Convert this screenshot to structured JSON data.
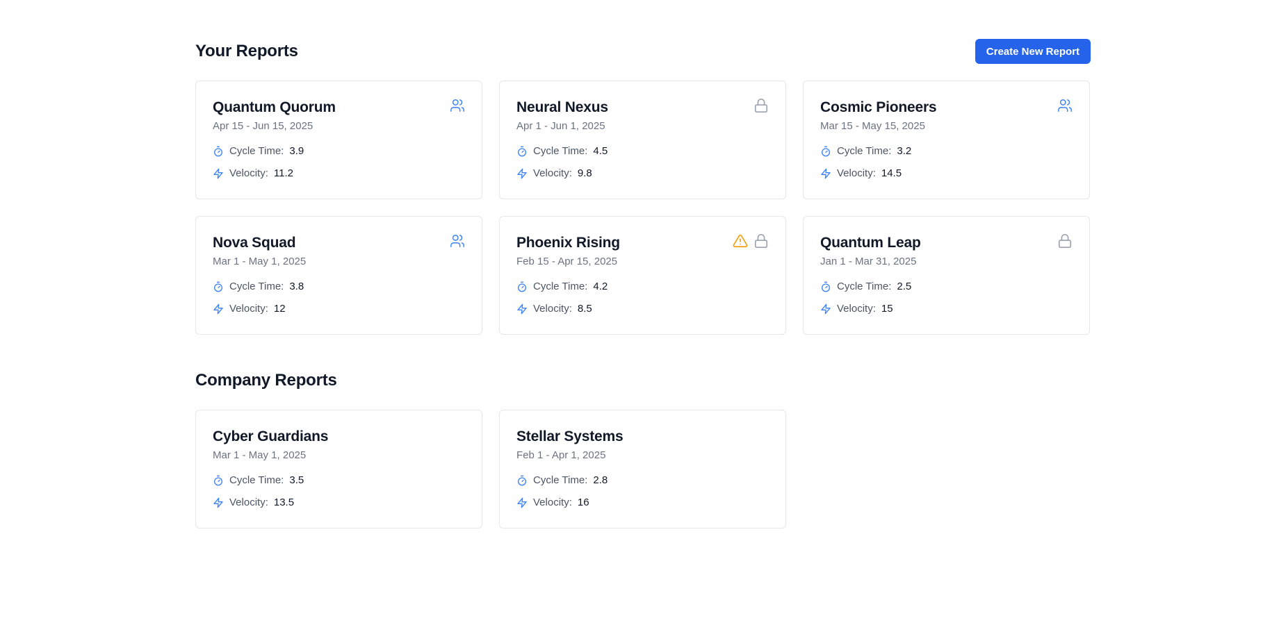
{
  "your_reports": {
    "title": "Your Reports",
    "create_button": "Create New Report",
    "cards": [
      {
        "title": "Quantum Quorum",
        "dates": "Apr 15 - Jun 15, 2025",
        "cycle_label": "Cycle Time:",
        "cycle_value": "3.9",
        "velocity_label": "Velocity:",
        "velocity_value": "11.2",
        "icons": [
          "users-icon"
        ]
      },
      {
        "title": "Neural Nexus",
        "dates": "Apr 1 - Jun 1, 2025",
        "cycle_label": "Cycle Time:",
        "cycle_value": "4.5",
        "velocity_label": "Velocity:",
        "velocity_value": "9.8",
        "icons": [
          "lock-icon"
        ]
      },
      {
        "title": "Cosmic Pioneers",
        "dates": "Mar 15 - May 15, 2025",
        "cycle_label": "Cycle Time:",
        "cycle_value": "3.2",
        "velocity_label": "Velocity:",
        "velocity_value": "14.5",
        "icons": [
          "users-icon"
        ]
      },
      {
        "title": "Nova Squad",
        "dates": "Mar 1 - May 1, 2025",
        "cycle_label": "Cycle Time:",
        "cycle_value": "3.8",
        "velocity_label": "Velocity:",
        "velocity_value": "12",
        "icons": [
          "users-icon"
        ]
      },
      {
        "title": "Phoenix Rising",
        "dates": "Feb 15 - Apr 15, 2025",
        "cycle_label": "Cycle Time:",
        "cycle_value": "4.2",
        "velocity_label": "Velocity:",
        "velocity_value": "8.5",
        "icons": [
          "warning-icon",
          "lock-icon"
        ]
      },
      {
        "title": "Quantum Leap",
        "dates": "Jan 1 - Mar 31, 2025",
        "cycle_label": "Cycle Time:",
        "cycle_value": "2.5",
        "velocity_label": "Velocity:",
        "velocity_value": "15",
        "icons": [
          "lock-icon"
        ]
      }
    ]
  },
  "company_reports": {
    "title": "Company Reports",
    "cards": [
      {
        "title": "Cyber Guardians",
        "dates": "Mar 1 - May 1, 2025",
        "cycle_label": "Cycle Time:",
        "cycle_value": "3.5",
        "velocity_label": "Velocity:",
        "velocity_value": "13.5",
        "icons": []
      },
      {
        "title": "Stellar Systems",
        "dates": "Feb 1 - Apr 1, 2025",
        "cycle_label": "Cycle Time:",
        "cycle_value": "2.8",
        "velocity_label": "Velocity:",
        "velocity_value": "16",
        "icons": []
      }
    ]
  },
  "colors": {
    "accent": "#2563eb",
    "metric_icon": "#3b82f6",
    "users_icon": "#3b82f6",
    "lock_icon": "#9ca3af",
    "warning_icon": "#f59e0b"
  }
}
